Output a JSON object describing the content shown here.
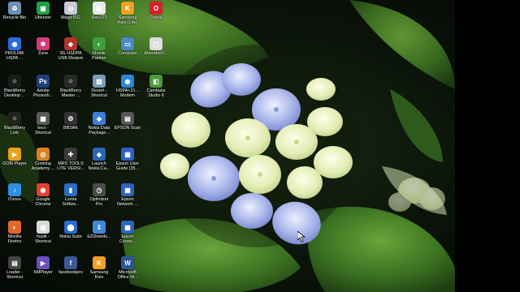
{
  "desktop": {
    "icons": [
      {
        "label": "Recycle Bin",
        "icon": "recycle-bin-icon",
        "color": "#6f8fb0",
        "glyph": "♻"
      },
      {
        "label": "PROLINK\nHSPA ...",
        "icon": "globe-icon",
        "color": "#2b6cd8",
        "glyph": "◉"
      },
      {
        "label": "BlackBerry\nDesktop ...",
        "icon": "blackberry-icon",
        "color": "#1b1b1b",
        "glyph": "⁘"
      },
      {
        "label": "BlackBerry\nLink",
        "icon": "blackberry-link-icon",
        "color": "#222222",
        "glyph": "⁘"
      },
      {
        "label": "GOM Player",
        "icon": "gom-player-icon",
        "color": "#e8a11a",
        "glyph": "▶"
      },
      {
        "label": "iTunes",
        "icon": "itunes-icon",
        "color": "#2f8fe0",
        "glyph": "♪"
      },
      {
        "label": "Mozilla\nFirefox",
        "icon": "firefox-icon",
        "color": "#e4672a",
        "glyph": "◐"
      },
      {
        "label": "Loader -\nShortcut",
        "icon": "loader-icon",
        "color": "#444444",
        "glyph": "▤"
      },
      {
        "label": "Uberizer",
        "icon": "uberizer-icon",
        "color": "#1aa34a",
        "glyph": "▣"
      },
      {
        "label": "Zune",
        "icon": "zune-icon",
        "color": "#d23a7a",
        "glyph": "✱"
      },
      {
        "label": "Adobe\nPhotosh...",
        "icon": "photoshop-icon",
        "color": "#1f3f7a",
        "glyph": "Ps"
      },
      {
        "label": "bect -\nShortcut",
        "icon": "bect-icon",
        "color": "#5a5a5a",
        "glyph": "▦"
      },
      {
        "label": "Cooking\nAcademy ...",
        "icon": "cooking-academy-icon",
        "color": "#d9811f",
        "glyph": "◎"
      },
      {
        "label": "Google\nChrome",
        "icon": "chrome-icon",
        "color": "#e44134",
        "glyph": "◉"
      },
      {
        "label": "hsplit -\nShortcut",
        "icon": "hsplit-icon",
        "color": "#d8d8d8",
        "glyph": "▥"
      },
      {
        "label": "KMPlayer",
        "icon": "kmplayer-icon",
        "color": "#6a4fbd",
        "glyph": "▶"
      },
      {
        "label": "MagicISO",
        "icon": "magiciso-icon",
        "color": "#c8c8d8",
        "glyph": "◎"
      },
      {
        "label": "3G HSDPA\nUSB Modem",
        "icon": "modem-icon",
        "color": "#b0342a",
        "glyph": "◈"
      },
      {
        "label": "BlackBerry\nMaster ...",
        "icon": "blackberry-master-icon",
        "color": "#2a2a2a",
        "glyph": "⁘"
      },
      {
        "label": "BBSAK",
        "icon": "bbsak-icon",
        "color": "#333333",
        "glyph": "⚙"
      },
      {
        "label": "MRS TOOLS\nLITE VERSI...",
        "icon": "mrs-tools-icon",
        "color": "#3b3b3b",
        "glyph": "✚"
      },
      {
        "label": "Lumia\nSoftwa...",
        "icon": "lumia-icon",
        "color": "#2d6cc7",
        "glyph": "▮"
      },
      {
        "label": "Nokia Suite",
        "icon": "nokia-suite-icon",
        "color": "#2a6bd1",
        "glyph": "⬤"
      },
      {
        "label": "facebookpro",
        "icon": "facebook-icon",
        "color": "#3b5998",
        "glyph": "f"
      },
      {
        "label": "Hao123",
        "icon": "hao123-icon",
        "color": "#e8e8e8",
        "glyph": "▤"
      },
      {
        "label": "Mobile\nPartner",
        "icon": "mobile-partner-icon",
        "color": "#3aa03a",
        "glyph": "◐"
      },
      {
        "label": "Desert -\nShortcut",
        "icon": "desert-icon",
        "color": "#7a9ab8",
        "glyph": "▨"
      },
      {
        "label": "Nokia Data\nPackage...",
        "icon": "nokia-data-icon",
        "color": "#3b7dd8",
        "glyph": "◆"
      },
      {
        "label": "Launch\nNokia Ca...",
        "icon": "nokia-care-icon",
        "color": "#2b64b8",
        "glyph": "◈"
      },
      {
        "label": "Optimizer\nPro",
        "icon": "optimizer-icon",
        "color": "#4b4b4b",
        "glyph": "◷"
      },
      {
        "label": "EZDownlo...",
        "icon": "ezdownload-icon",
        "color": "#3d8ad8",
        "glyph": "⇩"
      },
      {
        "label": "Samsung\nKies",
        "icon": "samsung-kies-icon",
        "color": "#f0a020",
        "glyph": "K"
      },
      {
        "label": "Samsung\nKies (Lite)",
        "icon": "samsung-kies-lite-icon",
        "color": "#f0a020",
        "glyph": "K"
      },
      {
        "label": "Computer",
        "icon": "computer-icon",
        "color": "#4a88c8",
        "glyph": "▭"
      },
      {
        "label": "HSPA+21...\nModem",
        "icon": "hspa-modem-icon",
        "color": "#2a86d8",
        "glyph": "◉"
      },
      {
        "label": "EPSON Scan",
        "icon": "epson-scan-icon",
        "color": "#555555",
        "glyph": "▤"
      },
      {
        "label": "Epson User\nGuide (35...",
        "icon": "epson-guide-icon",
        "color": "#2f62c0",
        "glyph": "▦"
      },
      {
        "label": "Epson\nNetwork ...",
        "icon": "epson-network-icon",
        "color": "#2f62c0",
        "glyph": "▦"
      },
      {
        "label": "Epson\nConne...",
        "icon": "epson-connect-icon",
        "color": "#2f62c0",
        "glyph": "▦"
      },
      {
        "label": "Microsoft\nOffice W...",
        "icon": "word-icon",
        "color": "#2b579a",
        "glyph": "W"
      },
      {
        "label": "Opera",
        "icon": "opera-icon",
        "color": "#d8202a",
        "glyph": "O"
      },
      {
        "label": "AttendeeV...",
        "icon": "attendee-icon",
        "color": "#dddddd",
        "glyph": "▢"
      },
      {
        "label": "Camtasia\nStudio 6",
        "icon": "camtasia-icon",
        "color": "#4a9a3a",
        "glyph": "◧"
      }
    ]
  },
  "colors": {
    "wallpaper_dark": "#0b140a",
    "leaf_green": "#3f7a2a",
    "petal_blue": "#8a9ee0",
    "petal_cream": "#eef3c8",
    "right_bar": "#000000"
  }
}
